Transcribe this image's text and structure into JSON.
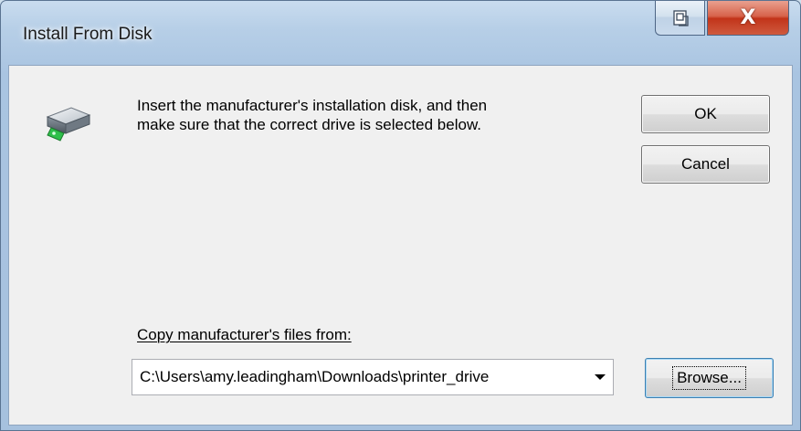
{
  "window": {
    "title": "Install From Disk",
    "close_glyph": "X"
  },
  "dialog": {
    "instruction": "Insert the manufacturer's installation disk, and then\nmake sure that the correct drive is selected below.",
    "copy_label": "Copy manufacturer's files from:",
    "path_value": "C:\\Users\\amy.leadingham\\Downloads\\printer_drive",
    "ok_label": "OK",
    "cancel_label": "Cancel",
    "browse_label": "Browse..."
  },
  "icons": {
    "disk": "disk-drive-icon",
    "help": "context-help-icon",
    "close": "close-icon",
    "dropdown": "chevron-down-icon"
  },
  "colors": {
    "close_button": "#c7432a",
    "focus_border": "#3c7fb1",
    "client_bg": "#f0f0f0"
  }
}
